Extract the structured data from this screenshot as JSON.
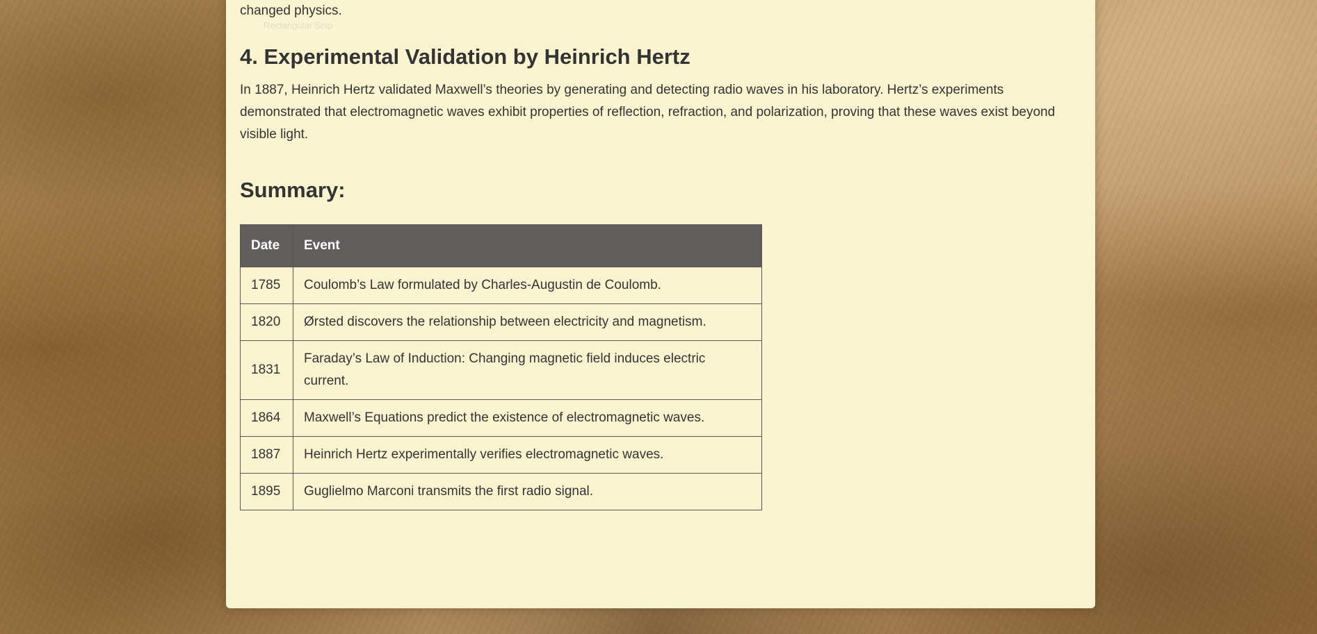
{
  "article": {
    "previous_paragraph_tail": "changed physics.",
    "ghost_label": "Rectangular Snip",
    "section_heading": "4. Experimental Validation by Heinrich Hertz",
    "section_paragraph": "In 1887, Heinrich Hertz validated Maxwell’s theories by generating and detecting radio waves in his laboratory. Hertz’s experiments demonstrated that electromagnetic waves exhibit properties of reflection, refraction, and polarization, proving that these waves exist beyond visible light.",
    "summary_heading": "Summary:"
  },
  "summary_table": {
    "headers": {
      "date": "Date",
      "event": "Event"
    },
    "rows": [
      {
        "date": "1785",
        "event": "Coulomb’s Law formulated by Charles-Augustin de Coulomb."
      },
      {
        "date": "1820",
        "event": "Ørsted discovers the relationship between electricity and magnetism."
      },
      {
        "date": "1831",
        "event": "Faraday’s Law of Induction: Changing magnetic field induces electric current."
      },
      {
        "date": "1864",
        "event": "Maxwell’s Equations predict the existence of electromagnetic waves."
      },
      {
        "date": "1887",
        "event": "Heinrich Hertz experimentally verifies electromagnetic waves."
      },
      {
        "date": "1895",
        "event": "Guglielmo Marconi transmits the first radio signal."
      }
    ]
  },
  "colors": {
    "page_background": "#faf3d0",
    "text": "#333333",
    "table_header_background": "#625e5e",
    "table_header_text": "#ffffff",
    "table_border": "#555555"
  }
}
